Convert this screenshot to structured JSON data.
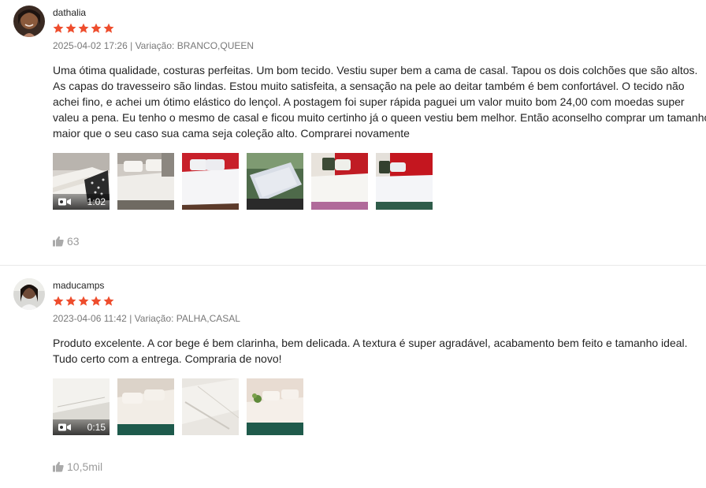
{
  "colors": {
    "star": "#ee4d2d",
    "meta_text": "#757575",
    "likes_text": "#999999",
    "divider": "#e8e8e8"
  },
  "reviews": [
    {
      "username": "dathalia",
      "rating": 5,
      "date": "2025-04-02 17:26",
      "separator": "|",
      "variation_label": "Variação: BRANCO,QUEEN",
      "comment": "Uma ótima qualidade, costuras perfeitas. Um bom tecido. Vestiu super bem a cama de casal. Tapou os dois colchões que são altos.\nAs capas do travesseiro são lindas. Estou muito satisfeita, a sensação na pele ao deitar também é bem confortável. O tecido não\nachei fino, e achei um ótimo elástico do lençol. A postagem foi super rápida paguei um valor muito bom 24,00 com moedas super\nvaleu a pena. Eu tenho o mesmo de casal e ficou muito certinho já o queen vestiu bem melhor. Então aconselho comprar um tamanho\nmaior que o seu caso sua cama seja coleção alto. Comprarei novamente",
      "video_duration": "1:02",
      "likes": "63",
      "icons": {
        "like": "thumbs-up-icon",
        "video": "video-camera-icon",
        "star": "star-icon"
      }
    },
    {
      "username": "maducamps",
      "rating": 5,
      "date": "2023-04-06 11:42",
      "separator": "|",
      "variation_label": "Variação: PALHA,CASAL",
      "comment": "Produto excelente. A cor bege é bem clarinha, bem delicada. A textura é super agradável, acabamento bem feito e tamanho ideal.\nTudo certo com a entrega. Compraria de novo!",
      "video_duration": "0:15",
      "likes": "10,5mil",
      "icons": {
        "like": "thumbs-up-icon",
        "video": "video-camera-icon",
        "star": "star-icon"
      }
    }
  ]
}
